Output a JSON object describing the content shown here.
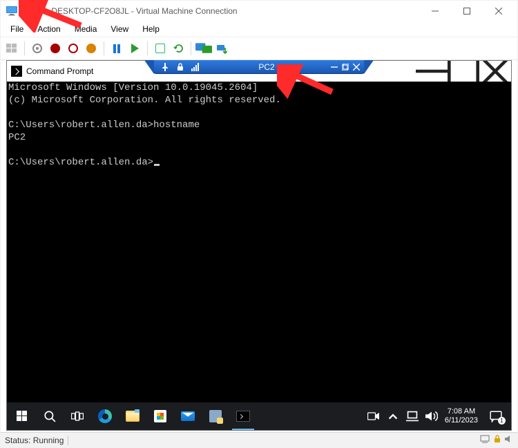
{
  "outer_window": {
    "title": "PC1 on DESKTOP-CF2O8JL - Virtual Machine Connection",
    "menu": {
      "file": "File",
      "action": "Action",
      "media": "Media",
      "view": "View",
      "help": "Help"
    },
    "status_label": "Status: Running"
  },
  "conn_bar": {
    "title": "PC2"
  },
  "cmd_window": {
    "title": "Command Prompt",
    "lines": {
      "l0": "Microsoft Windows [Version 10.0.19045.2604]",
      "l1": "(c) Microsoft Corporation. All rights reserved.",
      "l2": "",
      "l3": "C:\\Users\\robert.allen.da>hostname",
      "l4": "PC2",
      "l5": "",
      "l6": "C:\\Users\\robert.allen.da>"
    }
  },
  "taskbar": {
    "clock_time": "7:08 AM",
    "clock_date": "6/11/2023",
    "notif_count": "1"
  }
}
